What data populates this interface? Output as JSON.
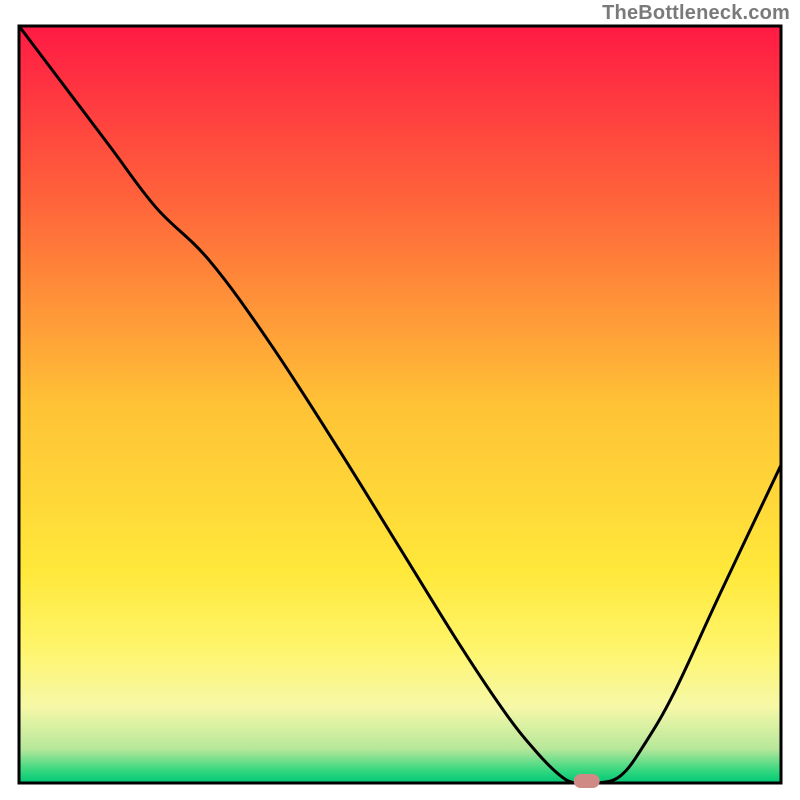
{
  "attribution": "TheBottleneck.com",
  "chart_data": {
    "type": "line",
    "title": "",
    "xlabel": "",
    "ylabel": "",
    "xlim": [
      0,
      100
    ],
    "ylim": [
      0,
      100
    ],
    "x": [
      0,
      6,
      12,
      18,
      25,
      33,
      42,
      50,
      58,
      64,
      68,
      71,
      73,
      76,
      79,
      82,
      86,
      92,
      100
    ],
    "values": [
      100,
      92,
      84,
      76,
      69,
      58,
      44,
      31,
      18,
      9,
      4,
      1,
      0,
      0,
      1,
      5,
      12,
      25,
      42
    ],
    "marker": {
      "x": 74.5,
      "y": 0,
      "color": "#cf8a86"
    },
    "gradient_stops": [
      {
        "offset": 0.0,
        "color": "#ff1a44"
      },
      {
        "offset": 0.25,
        "color": "#ff6a3a"
      },
      {
        "offset": 0.5,
        "color": "#ffc236"
      },
      {
        "offset": 0.72,
        "color": "#ffe83a"
      },
      {
        "offset": 0.82,
        "color": "#fff56a"
      },
      {
        "offset": 0.9,
        "color": "#f6f8a8"
      },
      {
        "offset": 0.955,
        "color": "#b6e79a"
      },
      {
        "offset": 0.985,
        "color": "#2fd67e"
      },
      {
        "offset": 1.0,
        "color": "#00c775"
      }
    ],
    "border_color": "#000000",
    "curve_color": "#000000"
  }
}
